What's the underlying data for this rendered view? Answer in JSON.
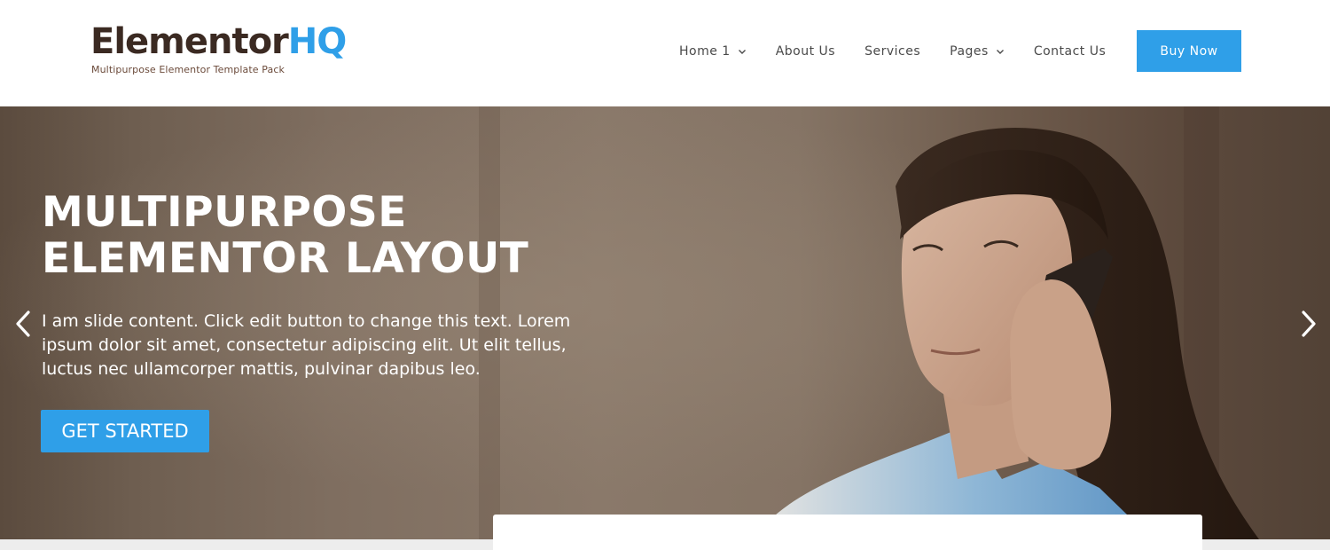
{
  "logo": {
    "part1": "Elementor",
    "part2": "HQ",
    "tagline": "Multipurpose Elementor Template Pack"
  },
  "nav": {
    "items": [
      {
        "label": "Home 1",
        "has_dropdown": true
      },
      {
        "label": "About Us",
        "has_dropdown": false
      },
      {
        "label": "Services",
        "has_dropdown": false
      },
      {
        "label": "Pages",
        "has_dropdown": true
      },
      {
        "label": "Contact Us",
        "has_dropdown": false
      }
    ],
    "cta_label": "Buy Now"
  },
  "hero": {
    "title": "MULTIPURPOSE\nELEMENTOR LAYOUT",
    "text": "I am slide content. Click edit button to change this text. Lorem ipsum dolor sit amet, consectetur adipiscing elit. Ut elit tellus, luctus nec ullamcorper mattis, pulvinar dapibus leo.",
    "button_label": "GET STARTED",
    "prev_icon": "chevron-left-icon",
    "next_icon": "chevron-right-icon"
  },
  "colors": {
    "accent": "#2f9fe8",
    "logo_dark": "#3b2a22",
    "nav_text": "#4a4a4a"
  }
}
